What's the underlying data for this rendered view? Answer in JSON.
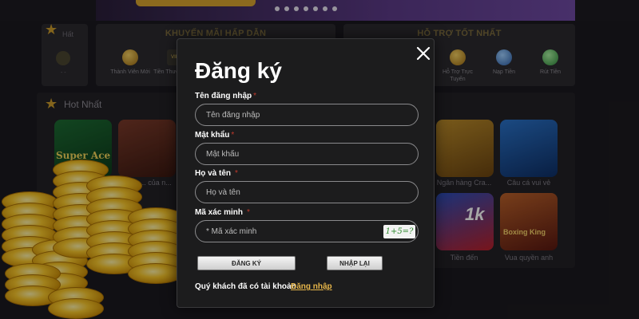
{
  "background": {
    "promo_panel": {
      "title": "KHUYẾN MÃI HẤP DẪN"
    },
    "support_panel": {
      "title": "HỖ TRỢ TỐT NHẤT"
    },
    "left_label": "Hất",
    "promo_items": [
      "Thành Viên Mới",
      "Tiền Thưởng VIP"
    ],
    "support_items": [
      "Hỗ Trợ Trực Tuyến",
      "Nạp Tiền",
      "Rút Tiền"
    ],
    "hot_section_title": "Hot Nhất",
    "games": [
      {
        "label": "",
        "card_text": "Super Ace"
      },
      {
        "label": "... của n...",
        "card_text": ""
      },
      {
        "label": "Ngân hàng Cra...",
        "card_text": ""
      },
      {
        "label": "Câu cá vui vẻ",
        "card_text": ""
      },
      {
        "label": "Tiền đến",
        "card_text": "1k"
      },
      {
        "label": "Vua quyền anh",
        "card_text": "Boxing King"
      }
    ],
    "vip_badge": "VIP",
    "dash": "- -"
  },
  "modal": {
    "title": "Đăng ký",
    "fields": [
      {
        "label": "Tên đăng nhập",
        "required_mark": "*",
        "placeholder": "Tên đăng nhập"
      },
      {
        "label": "Mật khẩu",
        "required_mark": "*",
        "placeholder": "Mật khẩu"
      },
      {
        "label": "Họ và tên",
        "required_mark": "*",
        "placeholder": "Họ và tên"
      },
      {
        "label": "Mã xác minh",
        "required_mark": "*",
        "placeholder": "* Mã xác minh"
      }
    ],
    "captcha_text": "1+5=?",
    "register_button": "ĐĂNG KÝ",
    "reset_button": "NHẬP LẠI",
    "footer_text": "Quý khách đã có tài khoản",
    "login_link": "Đăng nhập",
    "close_icon": "close-icon"
  },
  "colors": {
    "accent_gold": "#e7b64a",
    "required_red": "#c0392b"
  }
}
